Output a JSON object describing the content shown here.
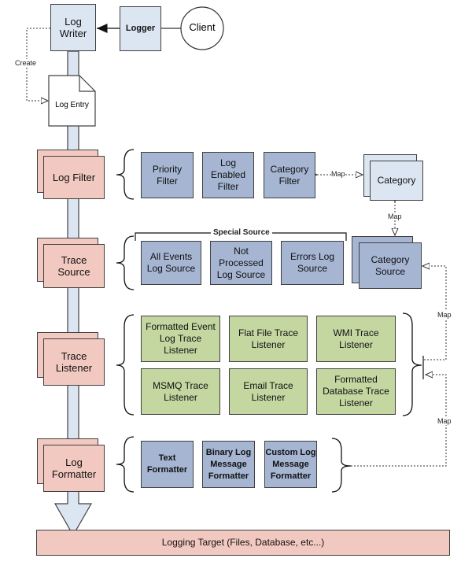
{
  "top": {
    "log_writer": "Log Writer",
    "logger": "Logger",
    "client": "Client",
    "create": "Create",
    "log_entry": "Log Entry"
  },
  "filter": {
    "stage": "Log Filter",
    "items": [
      "Priority Filter",
      "Log Enabled Filter",
      "Category Filter"
    ],
    "map": "Map",
    "category": "Category",
    "map_vertical": "Map"
  },
  "source": {
    "stage": "Trace Source",
    "special": "Special Source",
    "items": [
      "All Events Log Source",
      "Not Processed Log Source",
      "Errors Log Source"
    ],
    "category_source": "Category Source"
  },
  "listener": {
    "stage": "Trace Listener",
    "items": [
      "Formatted Event Log Trace Listener",
      "Flat File Trace Listener",
      "WMI Trace Listener",
      "MSMQ Trace Listener",
      "Email Trace Listener",
      "Formatted Database Trace Listener"
    ],
    "map_upper": "Map",
    "map_lower": "Map"
  },
  "formatter": {
    "stage": "Log Formatter",
    "items": [
      "Text Formatter",
      "Binary Log Message Formatter",
      "Custom Log Message Formatter"
    ]
  },
  "target": "Logging Target (Files, Database, etc...)",
  "colors": {
    "stage": "#f2c9c0",
    "component": "#a5b5d2",
    "listener": "#c4d7a1",
    "light": "#dce6f2"
  }
}
